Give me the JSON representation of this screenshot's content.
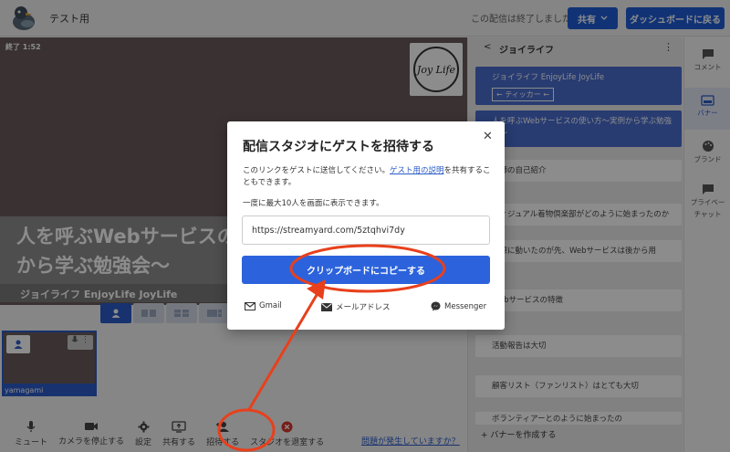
{
  "header": {
    "title": "テスト用",
    "status_text": "この配信は終了しました",
    "share_label": "共有",
    "dashboard_label": "ダッシュボードに戻る"
  },
  "stage": {
    "rec_time": "終了 1:52",
    "logo_text": "Joy Life",
    "banner_line1": "人を呼ぶWebサービスの使い方〜実例",
    "banner_line2": "から学ぶ勉強会〜",
    "ticker": "ジョイライフ EnjoyLife JoyLife"
  },
  "guest": {
    "name": "yamagami"
  },
  "toolbar": {
    "mute": "ミュート",
    "stop_camera": "カメラを停止する",
    "settings": "設定",
    "share": "共有する",
    "invite": "招待する",
    "leave": "スタジオを退室する",
    "problem": "問題が発生していますか？"
  },
  "right_panel": {
    "back": "<",
    "name": "ジョイライフ",
    "more": "⋮",
    "banners": [
      {
        "text": "ジョイライフ EnjoyLife JoyLife",
        "tag": "← ティッカー ←",
        "active": true
      },
      {
        "text": "人を呼ぶWebサービスの使い方〜実例から学ぶ勉強会〜",
        "active": true
      },
      {
        "text": "講師の自己紹介",
        "active": false
      },
      {
        "text": "ヴィジュアル着物倶楽部がどのように始まったのか",
        "active": false
      },
      {
        "text": "実際に動いたのが先、Webサービスは後から用",
        "active": false
      },
      {
        "text": "Webサービスの特徴",
        "active": false
      },
      {
        "text": "活動報告は大切",
        "active": false
      },
      {
        "text": "顧客リスト（ファンリスト）はとても大切",
        "active": false
      },
      {
        "text": "ボランティアーとのように始まったの",
        "active": false
      }
    ],
    "add_banner": "+ バナーを作成する"
  },
  "iconbar": {
    "comment": "コメント",
    "banner": "バナー",
    "brand": "ブランド",
    "private_chat_1": "プライベー",
    "private_chat_2": "チャット"
  },
  "modal": {
    "title": "配信スタジオにゲストを招待する",
    "desc_before": "このリンクをゲストに送信してください。",
    "desc_link": "ゲスト用の説明",
    "desc_after": "を共有することもできます。",
    "limit": "一度に最大10人を画面に表示できます。",
    "url": "https://streamyard.com/5ztqhvi7dy",
    "copy_label": "クリップボードにコピーする",
    "gmail": "Gmail",
    "email": "メールアドレス",
    "messenger": "Messenger"
  },
  "colors": {
    "primary": "#2c63dc",
    "annotation": "#e8401c"
  }
}
